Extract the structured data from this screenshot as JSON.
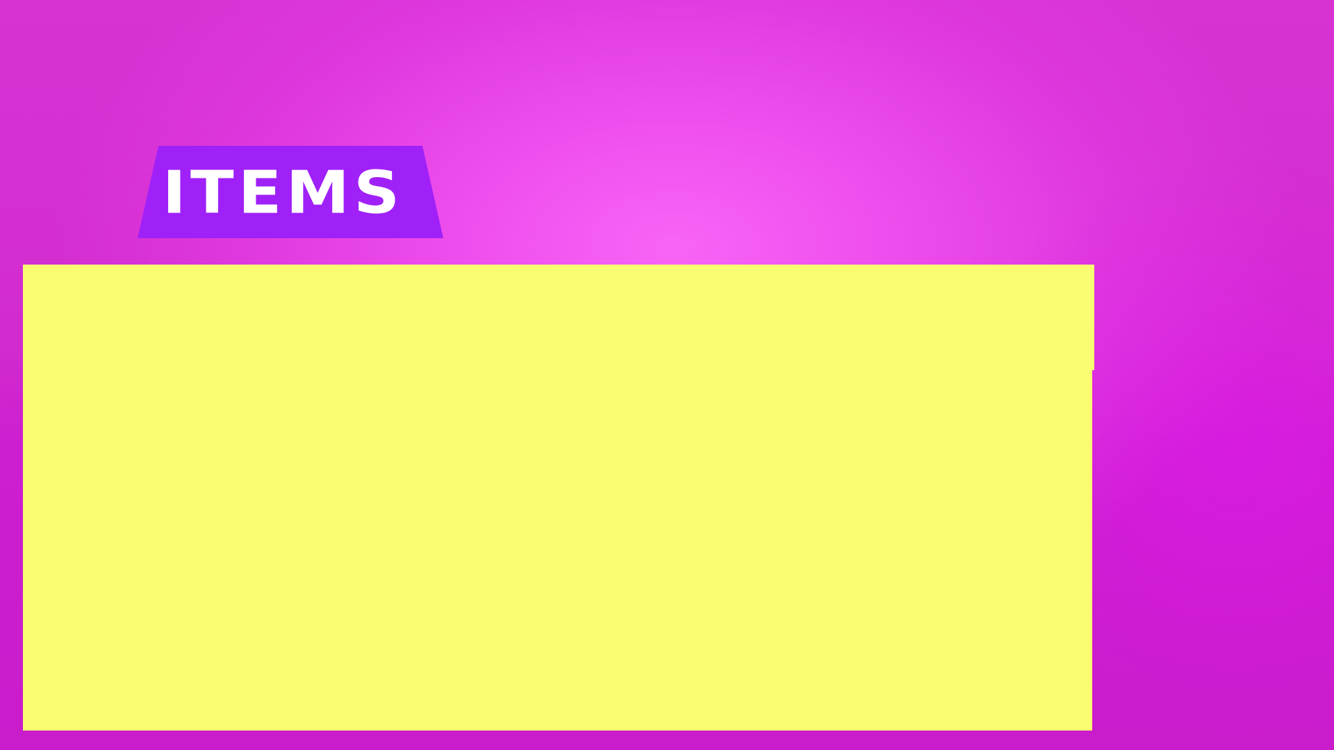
{
  "screen": {
    "background_color": "#e547e5",
    "highlight_color": "#f865f6"
  },
  "items_tab": {
    "label": "ITEMS",
    "color": "#a021f7",
    "text_color": "#ffffff"
  },
  "items_panel": {
    "color": "#f8fd72",
    "items": []
  }
}
